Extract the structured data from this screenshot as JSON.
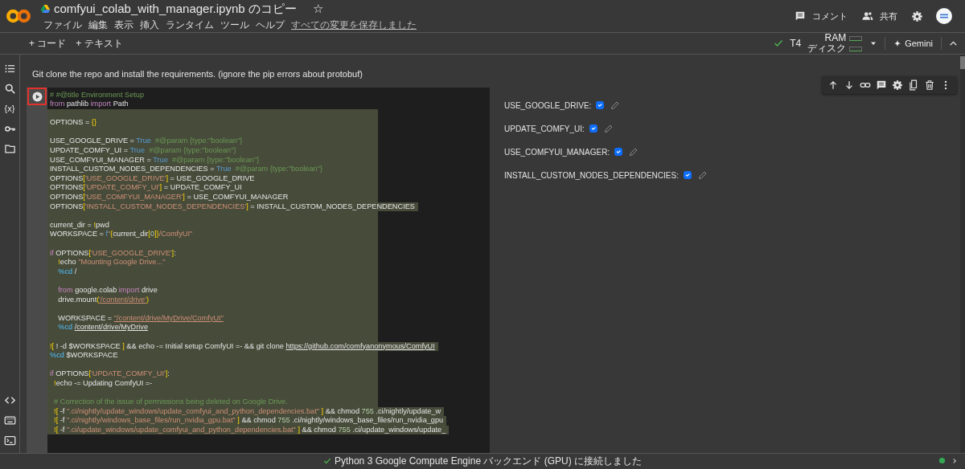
{
  "header": {
    "title": "comfyui_colab_with_manager.ipynb のコピー",
    "star": "☆",
    "menu": [
      "ファイル",
      "編集",
      "表示",
      "挿入",
      "ランタイム",
      "ツール",
      "ヘルプ"
    ],
    "save_status": "すべての変更を保存しました",
    "actions": [
      {
        "kind": "comment",
        "label": "コメント"
      },
      {
        "kind": "share",
        "label": "共有"
      }
    ]
  },
  "toolbar": {
    "add_buttons": [
      "+ コード",
      "+ テキスト"
    ],
    "runtime": "T4",
    "ram_label": "RAM",
    "disk_label": "ディスク",
    "connected": true,
    "gemini": "Gemini"
  },
  "sidebar": {
    "top": [
      {
        "kind": "toc"
      },
      {
        "kind": "search"
      },
      {
        "kind": "variables",
        "glyph": "{x}"
      },
      {
        "kind": "key"
      },
      {
        "kind": "folder"
      }
    ],
    "bottom": [
      {
        "kind": "code"
      },
      {
        "kind": "keyboard"
      },
      {
        "kind": "terminal"
      }
    ]
  },
  "markdown": "Git clone the repo and install the requirements. (ignore the pip errors about protobuf)",
  "cell": {
    "run_highlighted": true,
    "tools": [
      {
        "kind": "up"
      },
      {
        "kind": "down"
      },
      {
        "kind": "link"
      },
      {
        "kind": "comment"
      },
      {
        "kind": "settings"
      },
      {
        "kind": "mirror"
      },
      {
        "kind": "delete"
      },
      {
        "kind": "more"
      }
    ],
    "lines": [
      {
        "selected": false,
        "tokens": [
          {
            "kind": "comment",
            "text": "# #@title Environment Setup"
          }
        ]
      },
      {
        "selected": false,
        "tokens": [
          {
            "kind": "keyword",
            "text": "from"
          },
          {
            "kind": "plain",
            "text": " pathlib "
          },
          {
            "kind": "keyword",
            "text": "import"
          },
          {
            "kind": "plain",
            "text": " Path"
          }
        ]
      },
      {
        "selected": true
      },
      {
        "selected": true,
        "tokens": [
          {
            "kind": "plain",
            "text": "OPTIONS = "
          },
          {
            "kind": "bracket",
            "text": "{}"
          }
        ]
      },
      {
        "selected": true
      },
      {
        "selected": true,
        "tokens": [
          {
            "kind": "plain",
            "text": "USE_GOOGLE_DRIVE = "
          },
          {
            "kind": "const",
            "text": "True"
          },
          {
            "kind": "comment",
            "text": "  #@param {type:\"boolean\"}"
          }
        ]
      },
      {
        "selected": true,
        "tokens": [
          {
            "kind": "plain",
            "text": "UPDATE_COMFY_UI = "
          },
          {
            "kind": "const",
            "text": "True"
          },
          {
            "kind": "comment",
            "text": "  #@param {type:\"boolean\"}"
          }
        ]
      },
      {
        "selected": true,
        "tokens": [
          {
            "kind": "plain",
            "text": "USE_COMFYUI_MANAGER = "
          },
          {
            "kind": "const",
            "text": "True"
          },
          {
            "kind": "comment",
            "text": "  #@param {type:\"boolean\"}"
          }
        ]
      },
      {
        "selected": true,
        "tokens": [
          {
            "kind": "plain",
            "text": "INSTALL_CUSTOM_NODES_DEPENDENCIES = "
          },
          {
            "kind": "const",
            "text": "True"
          },
          {
            "kind": "comment",
            "text": "  #@param {type:\"boolean\"}"
          }
        ]
      },
      {
        "selected": true,
        "tokens": [
          {
            "kind": "plain",
            "text": "OPTIONS"
          },
          {
            "kind": "bracket",
            "text": "["
          },
          {
            "kind": "string",
            "text": "'USE_GOOGLE_DRIVE'"
          },
          {
            "kind": "bracket",
            "text": "]"
          },
          {
            "kind": "plain",
            "text": " = USE_GOOGLE_DRIVE"
          }
        ]
      },
      {
        "selected": true,
        "tokens": [
          {
            "kind": "plain",
            "text": "OPTIONS"
          },
          {
            "kind": "bracket",
            "text": "["
          },
          {
            "kind": "string",
            "text": "'UPDATE_COMFY_UI'"
          },
          {
            "kind": "bracket",
            "text": "]"
          },
          {
            "kind": "plain",
            "text": " = UPDATE_COMFY_UI"
          }
        ]
      },
      {
        "selected": true,
        "tokens": [
          {
            "kind": "plain",
            "text": "OPTIONS"
          },
          {
            "kind": "bracket",
            "text": "["
          },
          {
            "kind": "string",
            "text": "'USE_COMFYUI_MANAGER'"
          },
          {
            "kind": "bracket",
            "text": "]"
          },
          {
            "kind": "plain",
            "text": " = USE_COMFYUI_MANAGER"
          }
        ]
      },
      {
        "selected": true,
        "tokens": [
          {
            "kind": "plain",
            "text": "OPTIONS"
          },
          {
            "kind": "bracket",
            "text": "["
          },
          {
            "kind": "string",
            "text": "'INSTALL_CUSTOM_NODES_DEPENDENCIES'"
          },
          {
            "kind": "bracket",
            "text": "]"
          },
          {
            "kind": "plain",
            "text": " = INSTALL_CUSTOM_NODES_DEPENDENCIES"
          }
        ]
      },
      {
        "selected": true
      },
      {
        "selected": true,
        "tokens": [
          {
            "kind": "plain",
            "text": "current_dir = "
          },
          {
            "kind": "bracket",
            "text": "!"
          },
          {
            "kind": "plain",
            "text": "pwd"
          }
        ]
      },
      {
        "selected": true,
        "tokens": [
          {
            "kind": "plain",
            "text": "WORKSPACE = "
          },
          {
            "kind": "const",
            "text": "f"
          },
          {
            "kind": "string",
            "text": "\""
          },
          {
            "kind": "bracket",
            "text": "{"
          },
          {
            "kind": "plain",
            "text": "current_dir"
          },
          {
            "kind": "bracket",
            "text": "["
          },
          {
            "kind": "number",
            "text": "0"
          },
          {
            "kind": "bracket",
            "text": "]}"
          },
          {
            "kind": "string",
            "text": "/ComfyUI\""
          }
        ]
      },
      {
        "selected": true
      },
      {
        "selected": true,
        "tokens": [
          {
            "kind": "keyword",
            "text": "if"
          },
          {
            "kind": "plain",
            "text": " OPTIONS"
          },
          {
            "kind": "bracket",
            "text": "["
          },
          {
            "kind": "string",
            "text": "'USE_GOOGLE_DRIVE'"
          },
          {
            "kind": "bracket",
            "text": "]"
          },
          {
            "kind": "plain",
            "text": ":"
          }
        ]
      },
      {
        "selected": true,
        "tokens": [
          {
            "kind": "bracket",
            "text": "    !"
          },
          {
            "kind": "plain",
            "text": "echo "
          },
          {
            "kind": "string",
            "text": "\"Mounting Google Drive...\""
          }
        ]
      },
      {
        "selected": true,
        "tokens": [
          {
            "kind": "magic",
            "text": "    %cd"
          },
          {
            "kind": "plain",
            "text": " /"
          }
        ]
      },
      {
        "selected": true
      },
      {
        "selected": true,
        "tokens": [
          {
            "kind": "keyword",
            "text": "    from"
          },
          {
            "kind": "plain",
            "text": " google.colab "
          },
          {
            "kind": "keyword",
            "text": "import"
          },
          {
            "kind": "plain",
            "text": " drive"
          }
        ]
      },
      {
        "selected": true,
        "tokens": [
          {
            "kind": "plain",
            "text": "    drive.mount"
          },
          {
            "kind": "bracket",
            "text": "("
          },
          {
            "kind": "path",
            "text": "'/content/drive'"
          },
          {
            "kind": "bracket",
            "text": ")"
          }
        ]
      },
      {
        "selected": true
      },
      {
        "selected": true,
        "tokens": [
          {
            "kind": "plain",
            "text": "    WORKSPACE = "
          },
          {
            "kind": "path",
            "text": "\"/content/drive/MyDrive/ComfyUI\""
          }
        ]
      },
      {
        "selected": true,
        "tokens": [
          {
            "kind": "magic",
            "text": "    %cd "
          },
          {
            "kind": "link",
            "text": "/content/drive/MyDrive"
          }
        ]
      },
      {
        "selected": true
      },
      {
        "selected": true,
        "tokens": [
          {
            "kind": "bracket",
            "text": "!["
          },
          {
            "kind": "plain",
            "text": " ! -d $WORKSPACE "
          },
          {
            "kind": "bracket",
            "text": "]"
          },
          {
            "kind": "plain",
            "text": " && echo -= Initial setup ComfyUI =- && git clone "
          },
          {
            "kind": "link",
            "text": "https://github.com/comfyanonymous/ComfyUI"
          }
        ]
      },
      {
        "selected": true,
        "tokens": [
          {
            "kind": "magic",
            "text": "%cd"
          },
          {
            "kind": "plain",
            "text": " $WORKSPACE"
          }
        ]
      },
      {
        "selected": true
      },
      {
        "selected": true,
        "tokens": [
          {
            "kind": "keyword",
            "text": "if"
          },
          {
            "kind": "plain",
            "text": " OPTIONS"
          },
          {
            "kind": "bracket",
            "text": "["
          },
          {
            "kind": "string",
            "text": "'UPDATE_COMFY_UI'"
          },
          {
            "kind": "bracket",
            "text": "]"
          },
          {
            "kind": "plain",
            "text": ":"
          }
        ]
      },
      {
        "selected": true,
        "tokens": [
          {
            "kind": "bracket",
            "text": "  !"
          },
          {
            "kind": "plain",
            "text": "echo -= Updating ComfyUI =-"
          }
        ]
      },
      {
        "selected": true
      },
      {
        "selected": true,
        "tokens": [
          {
            "kind": "comment",
            "text": "  # Correction of the issue of permissions being deleted on Google Drive."
          }
        ]
      },
      {
        "selected": true,
        "tokens": [
          {
            "kind": "bracket",
            "text": "  !["
          },
          {
            "kind": "plain",
            "text": " -f "
          },
          {
            "kind": "string",
            "text": "\".ci/nightly/update_windows/update_comfyui_and_python_dependencies.bat\""
          },
          {
            "kind": "bracket",
            "text": " ]"
          },
          {
            "kind": "plain",
            "text": " && chmod "
          },
          {
            "kind": "number",
            "text": "755"
          },
          {
            "kind": "plain",
            "text": " .ci/nightly/update_w"
          }
        ]
      },
      {
        "selected": true,
        "tokens": [
          {
            "kind": "bracket",
            "text": "  !["
          },
          {
            "kind": "plain",
            "text": " -f "
          },
          {
            "kind": "string",
            "text": "\".ci/nightly/windows_base_files/run_nvidia_gpu.bat\""
          },
          {
            "kind": "bracket",
            "text": " ]"
          },
          {
            "kind": "plain",
            "text": " && chmod "
          },
          {
            "kind": "number",
            "text": "755"
          },
          {
            "kind": "plain",
            "text": " .ci/nightly/windows_base_files/run_nvidia_gpu"
          }
        ]
      },
      {
        "selected": true,
        "tokens": [
          {
            "kind": "bracket",
            "text": "  !["
          },
          {
            "kind": "plain",
            "text": " -f "
          },
          {
            "kind": "string",
            "text": "\".ci/update_windows/update_comfyui_and_python_dependencies.bat\""
          },
          {
            "kind": "bracket",
            "text": " ]"
          },
          {
            "kind": "plain",
            "text": " && chmod "
          },
          {
            "kind": "number",
            "text": "755"
          },
          {
            "kind": "plain",
            "text": " .ci/update_windows/update_"
          }
        ]
      }
    ],
    "form": [
      {
        "label": "USE_GOOGLE_DRIVE:",
        "checked": true
      },
      {
        "label": "UPDATE_COMFY_UI:",
        "checked": true
      },
      {
        "label": "USE_COMFYUI_MANAGER:",
        "checked": true
      },
      {
        "label": "INSTALL_CUSTOM_NODES_DEPENDENCIES:",
        "checked": true
      }
    ]
  },
  "status_bar": {
    "connected": true,
    "text": "Python 3 Google Compute Engine バックエンド (GPU) に接続しました"
  }
}
